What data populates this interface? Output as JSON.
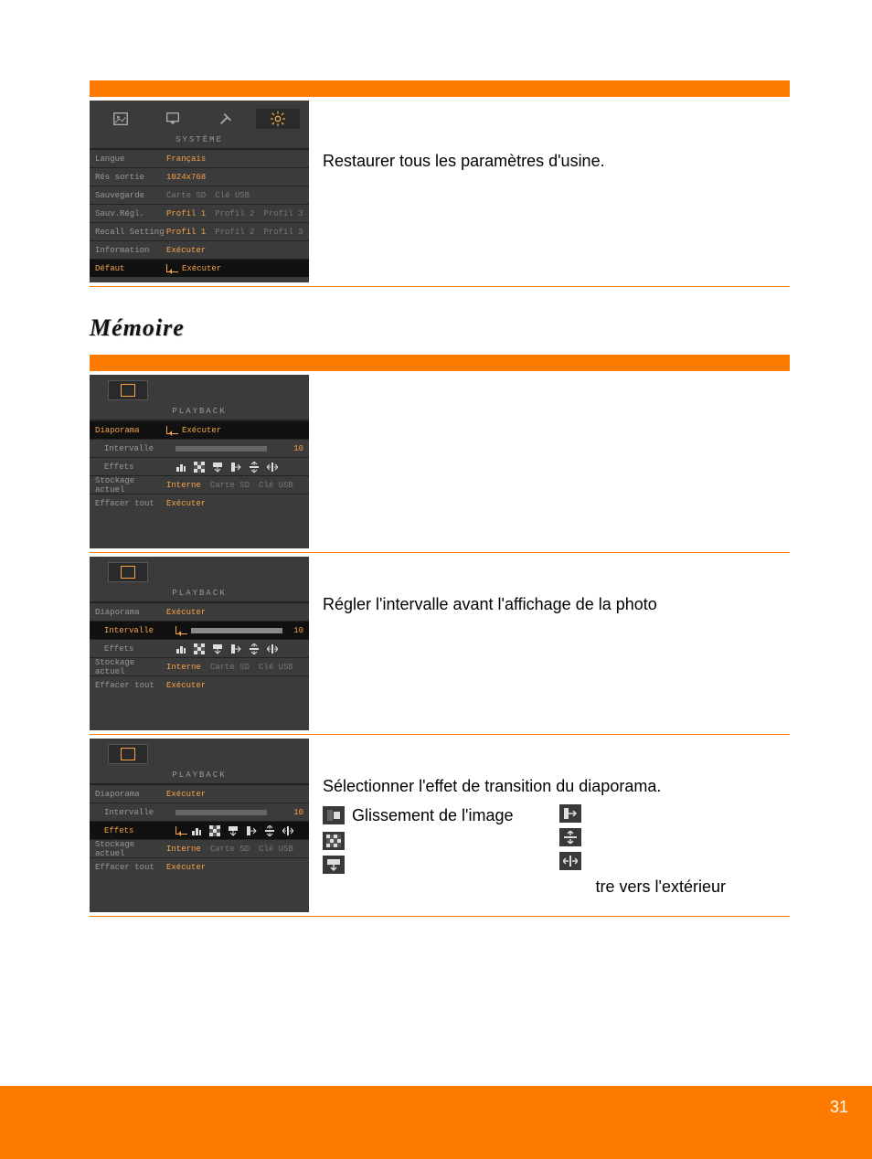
{
  "page_number": "31",
  "heading_memoire": "Mémoire",
  "section1": {
    "osd_title": "SYSTÈME",
    "rows": {
      "langue_label": "Langue",
      "langue_val": "Français",
      "res_label": "Rés sortie",
      "res_val": "1024x768",
      "sav_label": "Sauvegarde",
      "sav_v1": "Carte SD",
      "sav_v2": "Clé USB",
      "savregl_label": "Sauv.Régl.",
      "p1": "Profil 1",
      "p2": "Profil 2",
      "p3": "Profil 3",
      "recall_label": "Recall Setting",
      "info_label": "Information",
      "exec": "Exécuter",
      "defaut_label": "Défaut"
    },
    "desc": "Restaurer tous les paramètres d'usine."
  },
  "memoire": {
    "osd_title": "PLAYBACK",
    "diap_label": "Diaporama",
    "exec": "Exécuter",
    "interv_label": "Intervalle",
    "interv_num": "10",
    "effets_label": "Effets",
    "stock_label": "Stockage actuel",
    "stock_v1": "Interne",
    "stock_v2": "Carte SD",
    "stock_v3": "Clé USB",
    "eff_label": "Effacer tout",
    "desc_interv": "Régler l'intervalle avant l'affichage de la photo",
    "desc_eff": "Sélectionner l'effet de transition du diaporama.",
    "eff_glissement": "Glissement de l'image",
    "eff_tre": "tre vers l'extérieur"
  }
}
